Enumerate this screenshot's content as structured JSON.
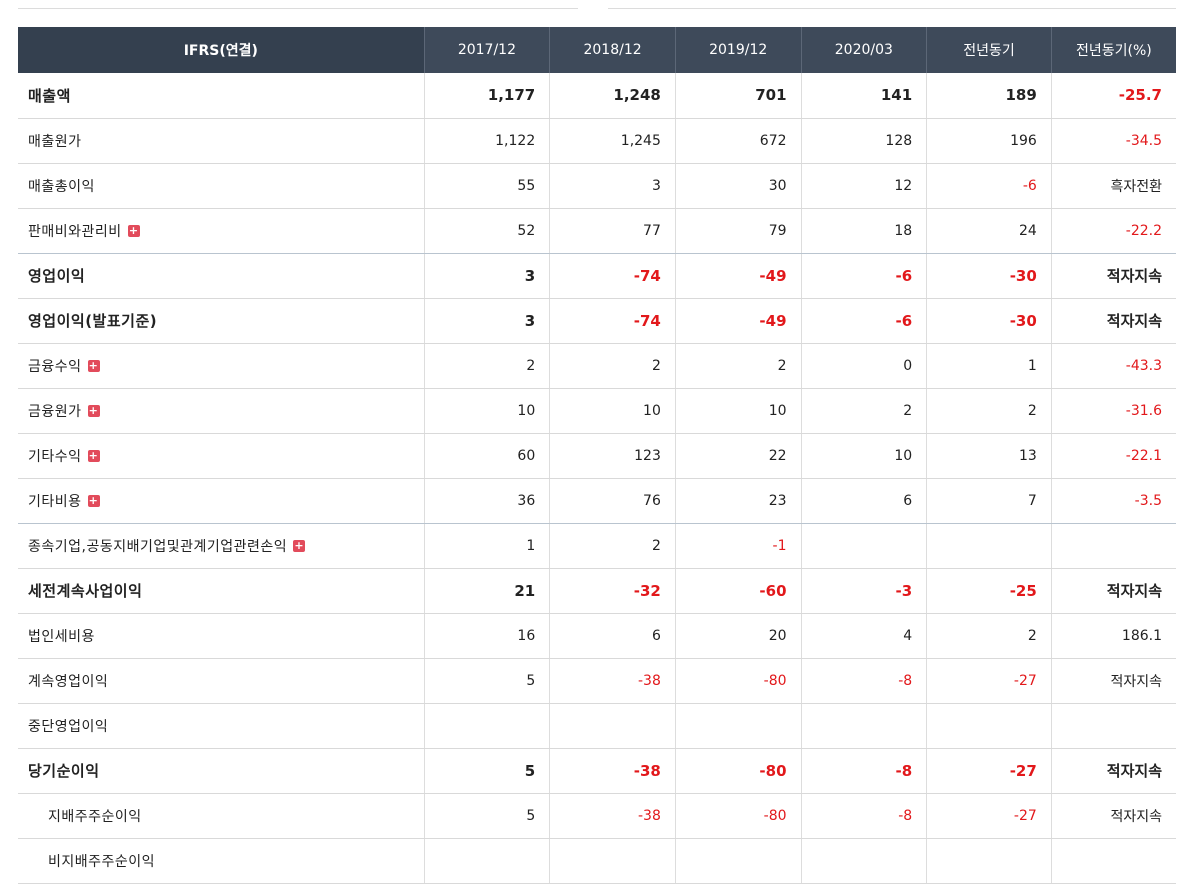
{
  "header": {
    "label": "IFRS(연결)",
    "cols": [
      "2017/12",
      "2018/12",
      "2019/12",
      "2020/03",
      "전년동기",
      "전년동기(%)"
    ]
  },
  "rows": [
    {
      "label": "매출액",
      "values": [
        "1,177",
        "1,248",
        "701",
        "141",
        "189",
        "-25.7"
      ],
      "bold": true,
      "expand": false
    },
    {
      "label": "매출원가",
      "values": [
        "1,122",
        "1,245",
        "672",
        "128",
        "196",
        "-34.5"
      ],
      "bold": false,
      "expand": false
    },
    {
      "label": "매출총이익",
      "values": [
        "55",
        "3",
        "30",
        "12",
        "-6",
        "흑자전환"
      ],
      "bold": false,
      "expand": false
    },
    {
      "label": "판매비와관리비",
      "values": [
        "52",
        "77",
        "79",
        "18",
        "24",
        "-22.2"
      ],
      "bold": false,
      "expand": true
    },
    {
      "label": "영업이익",
      "values": [
        "3",
        "-74",
        "-49",
        "-6",
        "-30",
        "적자지속"
      ],
      "bold": true,
      "expand": false
    },
    {
      "label": "영업이익(발표기준)",
      "values": [
        "3",
        "-74",
        "-49",
        "-6",
        "-30",
        "적자지속"
      ],
      "bold": true,
      "expand": false
    },
    {
      "label": "금융수익",
      "values": [
        "2",
        "2",
        "2",
        "0",
        "1",
        "-43.3"
      ],
      "bold": false,
      "expand": true
    },
    {
      "label": "금융원가",
      "values": [
        "10",
        "10",
        "10",
        "2",
        "2",
        "-31.6"
      ],
      "bold": false,
      "expand": true
    },
    {
      "label": "기타수익",
      "values": [
        "60",
        "123",
        "22",
        "10",
        "13",
        "-22.1"
      ],
      "bold": false,
      "expand": true
    },
    {
      "label": "기타비용",
      "values": [
        "36",
        "76",
        "23",
        "6",
        "7",
        "-3.5"
      ],
      "bold": false,
      "expand": true
    },
    {
      "label": "종속기업,공동지배기업및관계기업관련손익",
      "values": [
        "1",
        "2",
        "-1",
        "",
        "",
        ""
      ],
      "bold": false,
      "expand": true
    },
    {
      "label": "세전계속사업이익",
      "values": [
        "21",
        "-32",
        "-60",
        "-3",
        "-25",
        "적자지속"
      ],
      "bold": true,
      "expand": false
    },
    {
      "label": "법인세비용",
      "values": [
        "16",
        "6",
        "20",
        "4",
        "2",
        "186.1"
      ],
      "bold": false,
      "expand": false
    },
    {
      "label": "계속영업이익",
      "values": [
        "5",
        "-38",
        "-80",
        "-8",
        "-27",
        "적자지속"
      ],
      "bold": false,
      "expand": false
    },
    {
      "label": "중단영업이익",
      "values": [
        "",
        "",
        "",
        "",
        "",
        ""
      ],
      "bold": false,
      "expand": false
    },
    {
      "label": "당기순이익",
      "values": [
        "5",
        "-38",
        "-80",
        "-8",
        "-27",
        "적자지속"
      ],
      "bold": true,
      "expand": false
    },
    {
      "label": "지배주주순이익",
      "values": [
        "5",
        "-38",
        "-80",
        "-8",
        "-27",
        "적자지속"
      ],
      "bold": false,
      "expand": false,
      "sub": true
    },
    {
      "label": "비지배주주순이익",
      "values": [
        "",
        "",
        "",
        "",
        "",
        ""
      ],
      "bold": false,
      "expand": false,
      "sub": true
    }
  ],
  "expand_icon": "plus-icon",
  "colors": {
    "header_bg": "#3e4a5a",
    "negative": "#e2181b",
    "expand": "#e24b5b"
  }
}
